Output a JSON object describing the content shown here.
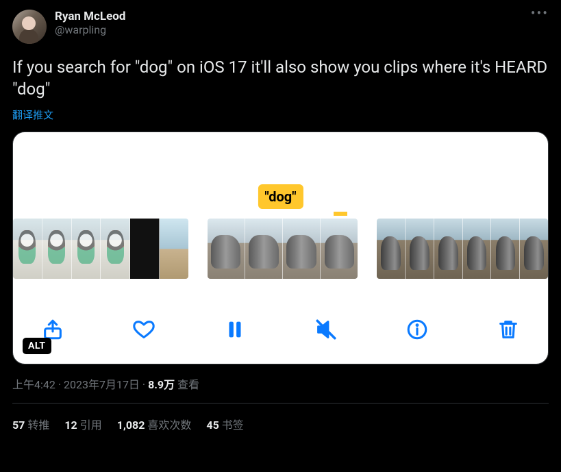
{
  "author": {
    "display_name": "Ryan McLeod",
    "handle": "@warpling"
  },
  "tweet_text": "If you search for \"dog\" on iOS 17 it'll also show you clips where it's HEARD \"dog\"",
  "translate_label": "翻译推文",
  "media": {
    "search_tag": "\"dog\"",
    "alt_badge": "ALT"
  },
  "meta": {
    "time": "上午4:42",
    "separator": " · ",
    "date": "2023年7月17日",
    "views_count": "8.9万",
    "views_label": " 查看"
  },
  "stats": {
    "retweets_count": "57",
    "retweets_label": "转推",
    "quotes_count": "12",
    "quotes_label": "引用",
    "likes_count": "1,082",
    "likes_label": "喜欢次数",
    "bookmarks_count": "45",
    "bookmarks_label": "书签"
  }
}
